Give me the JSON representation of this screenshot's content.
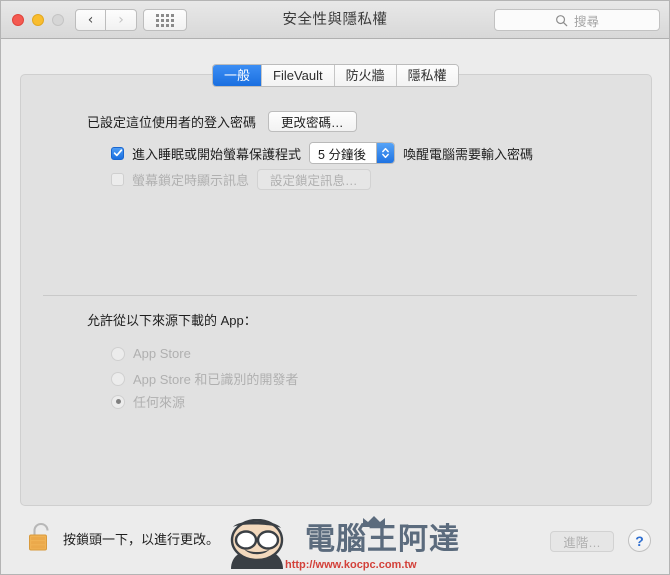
{
  "window": {
    "title": "安全性與隱私權",
    "traffic_lights": [
      "close",
      "minimize",
      "zoom"
    ]
  },
  "toolbar": {
    "back_icon": "chevron-left-icon",
    "forward_icon": "chevron-right-icon",
    "show_all_icon": "grid-dots-icon",
    "search": {
      "icon": "search-icon",
      "placeholder": "搜尋",
      "value": ""
    }
  },
  "tabs": [
    {
      "label": "一般",
      "active": true
    },
    {
      "label": "FileVault",
      "active": false
    },
    {
      "label": "防火牆",
      "active": false
    },
    {
      "label": "隱私權",
      "active": false
    }
  ],
  "general": {
    "password_status": "已設定這位使用者的登入密碼",
    "change_password_button": "更改密碼…",
    "require_password": {
      "checked": true,
      "label_before": "進入睡眠或開始螢幕保護程式",
      "delay_value": "5 分鐘後",
      "label_after": "喚醒電腦需要輸入密碼"
    },
    "lock_message": {
      "checked": false,
      "enabled": false,
      "label": "螢幕鎖定時顯示訊息",
      "set_message_button": "設定鎖定訊息…"
    },
    "download_sources": {
      "title": "允許從以下來源下載的 App：",
      "options": [
        {
          "label": "App Store",
          "selected": false
        },
        {
          "label": "App Store 和已識別的開發者",
          "selected": false
        },
        {
          "label": "任何來源",
          "selected": true
        }
      ],
      "enabled": false
    }
  },
  "footer": {
    "lock_icon": "lock-open-icon",
    "lock_text": "按鎖頭一下，以進行更改。",
    "advanced_button": "進階…",
    "help_button": "?"
  },
  "watermark": {
    "brand": "電腦王阿達",
    "url": "http://www.kocpc.com.tw"
  },
  "colors": {
    "accent_blue": "#1a6fe0",
    "window_bg": "#ececec",
    "panel_bg": "#e1e1e1",
    "lock_gold": "#f0b254",
    "watermark_text": "#5b6b7d",
    "watermark_url": "#d3413a"
  }
}
